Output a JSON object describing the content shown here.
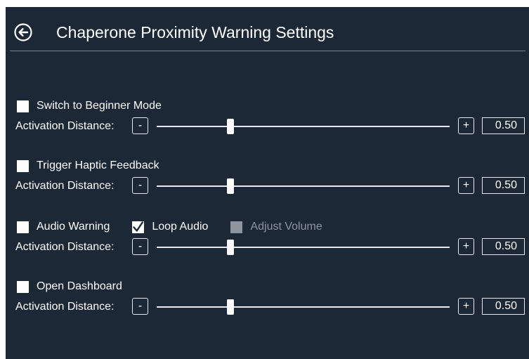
{
  "header": {
    "title": "Chaperone Proximity Warning Settings",
    "back_icon": "back-arrow-circle-icon"
  },
  "sections": [
    {
      "options": [
        {
          "label": "Switch to Beginner Mode",
          "checked": false,
          "disabled": false
        }
      ],
      "distance": {
        "label": "Activation Distance:",
        "minus": "-",
        "plus": "+",
        "value": "0.50"
      }
    },
    {
      "options": [
        {
          "label": "Trigger Haptic Feedback",
          "checked": false,
          "disabled": false
        }
      ],
      "distance": {
        "label": "Activation Distance:",
        "minus": "-",
        "plus": "+",
        "value": "0.50"
      }
    },
    {
      "options": [
        {
          "label": "Audio Warning",
          "checked": false,
          "disabled": false
        },
        {
          "label": "Loop Audio",
          "checked": true,
          "disabled": false
        },
        {
          "label": "Adjust Volume",
          "checked": false,
          "disabled": true
        }
      ],
      "distance": {
        "label": "Activation Distance:",
        "minus": "-",
        "plus": "+",
        "value": "0.50"
      }
    },
    {
      "options": [
        {
          "label": "Open Dashboard",
          "checked": false,
          "disabled": false
        }
      ],
      "distance": {
        "label": "Activation Distance:",
        "minus": "-",
        "plus": "+",
        "value": "0.50"
      }
    }
  ],
  "colors": {
    "background": "#1d2836",
    "text": "#ffffff",
    "disabled": "#8d949d"
  }
}
